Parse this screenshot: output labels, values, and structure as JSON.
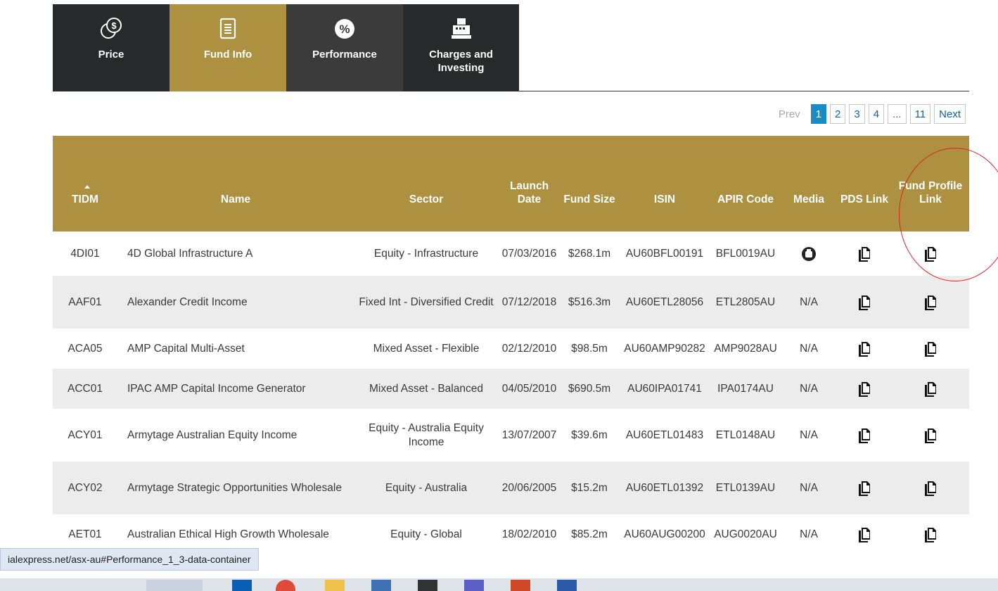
{
  "tabs": [
    {
      "label": "Price",
      "icon": "dollar-coins-icon"
    },
    {
      "label": "Fund Info",
      "icon": "document-list-icon"
    },
    {
      "label": "Performance",
      "icon": "percent-icon"
    },
    {
      "label": "Charges and Investing",
      "icon": "cash-register-icon"
    }
  ],
  "pager": {
    "prev": "Prev",
    "pages": [
      "1",
      "2",
      "3",
      "4",
      "...",
      "11"
    ],
    "next": "Next",
    "active": "1"
  },
  "table": {
    "headers": {
      "tidm": "TIDM",
      "name": "Name",
      "sector": "Sector",
      "launch": "Launch Date",
      "size": "Fund Size",
      "isin": "ISIN",
      "apir": "APIR Code",
      "media": "Media",
      "pds": "PDS Link",
      "profile": "Fund Profile Link"
    },
    "rows": [
      {
        "tidm": "4DI01",
        "name": "4D Global Infrastructure A",
        "sector": "Equity - Infrastructure",
        "launch": "07/03/2016",
        "size": "$268.1m",
        "isin": "AU60BFL00191",
        "apir": "BFL0019AU",
        "media": "",
        "has_media_icon": true
      },
      {
        "tidm": "AAF01",
        "name": "Alexander Credit Income",
        "sector": "Fixed Int - Diversified Credit",
        "launch": "07/12/2018",
        "size": "$516.3m",
        "isin": "AU60ETL28056",
        "apir": "ETL2805AU",
        "media": "N/A"
      },
      {
        "tidm": "ACA05",
        "name": "AMP Capital Multi-Asset",
        "sector": "Mixed Asset - Flexible",
        "launch": "02/12/2010",
        "size": "$98.5m",
        "isin": "AU60AMP90282",
        "apir": "AMP9028AU",
        "media": "N/A"
      },
      {
        "tidm": "ACC01",
        "name": "IPAC AMP Capital Income Generator",
        "sector": "Mixed Asset - Balanced",
        "launch": "04/05/2010",
        "size": "$690.5m",
        "isin": "AU60IPA01741",
        "apir": "IPA0174AU",
        "media": "N/A"
      },
      {
        "tidm": "ACY01",
        "name": "Armytage Australian Equity Income",
        "sector": "Equity - Australia Equity Income",
        "launch": "13/07/2007",
        "size": "$39.6m",
        "isin": "AU60ETL01483",
        "apir": "ETL0148AU",
        "media": "N/A"
      },
      {
        "tidm": "ACY02",
        "name": "Armytage Strategic Opportunities Wholesale",
        "sector": "Equity - Australia",
        "launch": "20/06/2005",
        "size": "$15.2m",
        "isin": "AU60ETL01392",
        "apir": "ETL0139AU",
        "media": "N/A"
      },
      {
        "tidm": "AET01",
        "name": "Australian Ethical High Growth Wholesale",
        "sector": "Equity - Global",
        "launch": "18/02/2010",
        "size": "$85.2m",
        "isin": "AU60AUG00200",
        "apir": "AUG0020AU",
        "media": "N/A"
      }
    ]
  },
  "status_url": "ialexpress.net/asx-au#Performance_1_3-data-container",
  "colors": {
    "gold": "#ad9140",
    "dark": "#262a2b",
    "active_page": "#1a8bc4",
    "annotation": "#e02020"
  }
}
